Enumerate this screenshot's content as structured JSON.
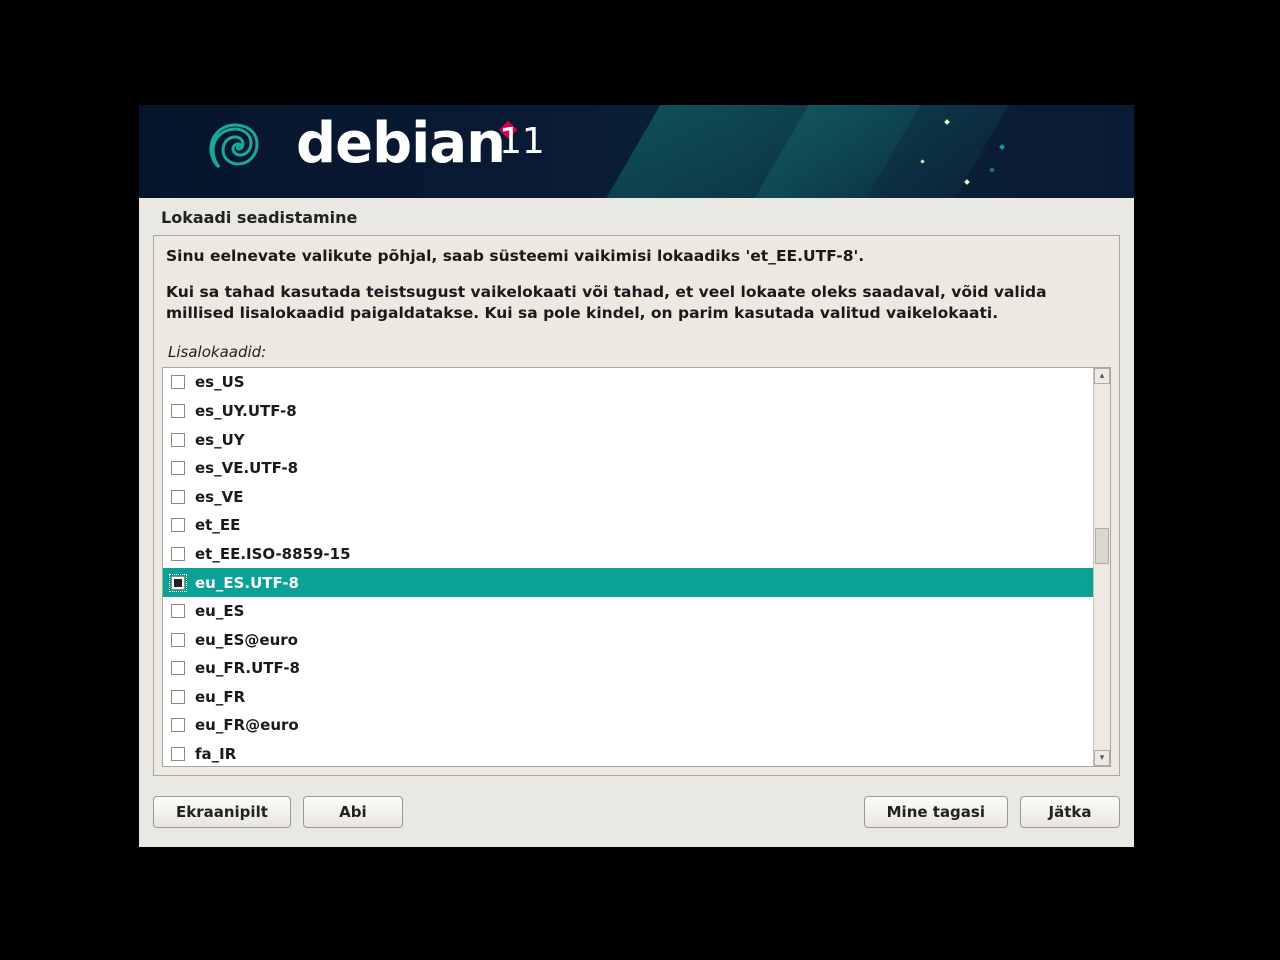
{
  "banner": {
    "product": "debian",
    "version": "11"
  },
  "page_title": "Lokaadi seadistamine",
  "description": {
    "line1": "Sinu eelnevate valikute põhjal, saab süsteemi vaikimisi lokaadiks 'et_EE.UTF-8'.",
    "line2": "Kui sa tahad kasutada teistsugust vaikelokaati või tahad, et veel lokaate oleks saadaval, võid valida millised lisalokaadid paigaldatakse. Kui sa pole kindel, on parim kasutada valitud vaikelokaati."
  },
  "list_label": "Lisalokaadid:",
  "locales": [
    {
      "label": "es_US",
      "checked": false,
      "selected": false
    },
    {
      "label": "es_UY.UTF-8",
      "checked": false,
      "selected": false
    },
    {
      "label": "es_UY",
      "checked": false,
      "selected": false
    },
    {
      "label": "es_VE.UTF-8",
      "checked": false,
      "selected": false
    },
    {
      "label": "es_VE",
      "checked": false,
      "selected": false
    },
    {
      "label": "et_EE",
      "checked": false,
      "selected": false
    },
    {
      "label": "et_EE.ISO-8859-15",
      "checked": false,
      "selected": false
    },
    {
      "label": "eu_ES.UTF-8",
      "checked": true,
      "selected": true
    },
    {
      "label": "eu_ES",
      "checked": false,
      "selected": false
    },
    {
      "label": "eu_ES@euro",
      "checked": false,
      "selected": false
    },
    {
      "label": "eu_FR.UTF-8",
      "checked": false,
      "selected": false
    },
    {
      "label": "eu_FR",
      "checked": false,
      "selected": false
    },
    {
      "label": "eu_FR@euro",
      "checked": false,
      "selected": false
    },
    {
      "label": "fa_IR",
      "checked": false,
      "selected": false
    }
  ],
  "buttons": {
    "screenshot": "Ekraanipilt",
    "help": "Abi",
    "back": "Mine tagasi",
    "continue": "Jätka"
  }
}
